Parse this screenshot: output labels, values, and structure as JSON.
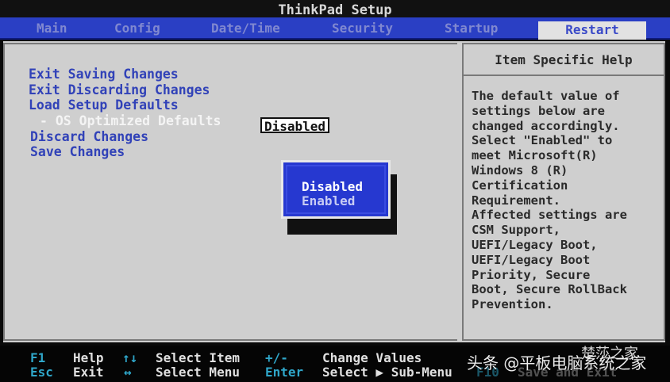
{
  "app": {
    "title": "ThinkPad Setup"
  },
  "menu": {
    "tabs": [
      {
        "label": "Main"
      },
      {
        "label": "Config"
      },
      {
        "label": "Date/Time"
      },
      {
        "label": "Security"
      },
      {
        "label": "Startup"
      },
      {
        "label": "Restart"
      }
    ],
    "active_tab": "Restart"
  },
  "options": {
    "exit_saving": "Exit Saving Changes",
    "exit_discarding": "Exit Discarding Changes",
    "load_defaults": "Load Setup Defaults",
    "os_optimized": "- OS Optimized Defaults",
    "os_optimized_value": "Disabled",
    "discard_changes": "Discard Changes",
    "save_changes": "Save Changes"
  },
  "popup": {
    "options": [
      "Disabled",
      "Enabled"
    ],
    "selected": "Disabled"
  },
  "help": {
    "title": "Item Specific Help",
    "text": "The default value of\nsettings below are\nchanged accordingly.\nSelect \"Enabled\" to\nmeet Microsoft(R)\nWindows 8 (R)\nCertification\nRequirement.\nAffected settings are\nCSM Support,\nUEFI/Legacy Boot,\nUEFI/Legacy Boot\nPriority, Secure\nBoot, Secure RollBack\nPrevention."
  },
  "footer": {
    "f1_key": "F1",
    "f1_label": "Help",
    "esc_key": "Esc",
    "esc_label": "Exit",
    "updown_key": "↑↓",
    "updown_label": "Select Item",
    "leftright_key": "↔",
    "leftright_label": "Select Menu",
    "plusminus_key": "+/-",
    "plusminus_label": "Change Values",
    "enter_key": "Enter",
    "enter_label": "Select ▶ Sub-Menu",
    "f10_key": "F10",
    "f10_label": "Save and Exit"
  },
  "watermark": {
    "source": "头条 @平板电脑系统之家",
    "brand": "楚莎之家"
  },
  "colors": {
    "menubar_bg": "#2a3fc4",
    "main_bg": "#cfcfcf",
    "option_text": "#3142b8",
    "popup_bg": "#2638d0",
    "footer_key": "#2fa6c9"
  }
}
